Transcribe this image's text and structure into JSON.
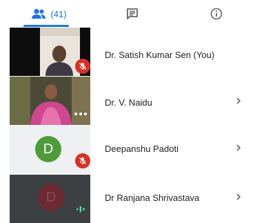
{
  "tabs": {
    "people_count": "(41)",
    "people_icon": "people-icon",
    "chat_icon": "chat-icon",
    "info_icon": "info-icon"
  },
  "colors": {
    "accent": "#1a73e8",
    "mute_red": "#d93025",
    "avatar_green": "#4f9a3a",
    "avatar_maroon": "#6b2a33",
    "speaking_green": "#5cd9a0"
  },
  "participants": [
    {
      "name": "Dr. Satish Kumar Sen (You)",
      "tile": "video",
      "muted": true
    },
    {
      "name": "Dr. V. Naidu",
      "tile": "video",
      "muted": false,
      "more_dots": true
    },
    {
      "name": "Deepanshu Padoti",
      "tile": "avatar",
      "initial": "D",
      "muted": true
    },
    {
      "name": "Dr Ranjana Shrivastava",
      "tile": "avatar",
      "initial": "D",
      "muted": false,
      "speaking": true
    }
  ]
}
